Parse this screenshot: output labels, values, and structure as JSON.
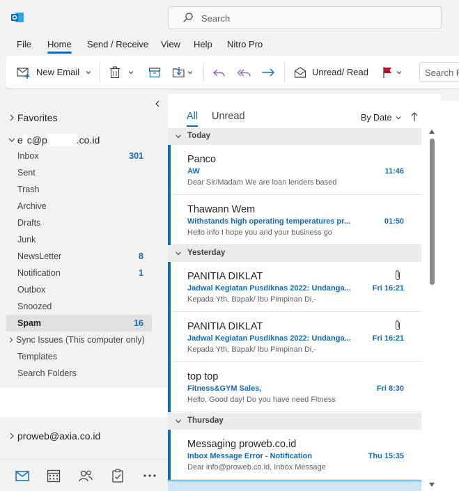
{
  "titlebar": {
    "app_icon": "outlook-logo-icon",
    "search": {
      "placeholder": "Search",
      "icon": "search-icon"
    }
  },
  "menu": {
    "tabs": [
      {
        "label": "File"
      },
      {
        "label": "Home",
        "active": true
      },
      {
        "label": "Send / Receive"
      },
      {
        "label": "View"
      },
      {
        "label": "Help"
      },
      {
        "label": "Nitro Pro"
      }
    ]
  },
  "ribbon": {
    "new_email": "New Email",
    "unread_read": "Unread/ Read",
    "search_placeholder": "Search P",
    "icons": [
      "new-email-icon",
      "delete-icon",
      "archive-icon",
      "move-icon",
      "undo-icon",
      "reply-all-icon",
      "forward-icon",
      "envelope-open-icon",
      "flag-icon"
    ]
  },
  "folders": {
    "favorites": "Favorites",
    "account_prefix": "e",
    "account_mid": "c@p",
    "account_suffix": ".co.id",
    "items": [
      {
        "name": "Inbox",
        "count": "301"
      },
      {
        "name": "Sent",
        "count": ""
      },
      {
        "name": "Trash",
        "count": ""
      },
      {
        "name": "Archive",
        "count": ""
      },
      {
        "name": "Drafts",
        "count": ""
      },
      {
        "name": "Junk",
        "count": ""
      },
      {
        "name": "NewsLetter",
        "count": "8"
      },
      {
        "name": "Notification",
        "count": "1"
      },
      {
        "name": "Outbox",
        "count": ""
      },
      {
        "name": "Snoozed",
        "count": ""
      },
      {
        "name": "Spam",
        "count": "16",
        "selected": true
      }
    ],
    "sync_issues": "Sync Issues (This computer only)",
    "templates": "Templates",
    "search_folders": "Search Folders",
    "account2": "proweb@axia.co.id"
  },
  "navbar": [
    "mail-icon",
    "calendar-icon",
    "people-icon",
    "tasks-icon",
    "more-icon"
  ],
  "list": {
    "filter_all": "All",
    "filter_unread": "Unread",
    "sort_label": "By Date",
    "groups": {
      "today": "Today",
      "yesterday": "Yesterday",
      "thursday": "Thursday"
    },
    "messages": [
      {
        "sender": "Panco",
        "subject": "AW",
        "time": "11:46",
        "preview": "Dear Sir/Madam  We are loan lenders based",
        "attachment": false
      },
      {
        "sender": "Thawann Wem",
        "subject": "Withstands high operating temperatures pr...",
        "time": "01:50",
        "preview": "Hello info  I hope you and your business go",
        "attachment": false
      },
      {
        "sender": "PANITIA DIKLAT",
        "subject": "Jadwal Kegiatan Pusdiknas 2022:  Undanga...",
        "time": "Fri 16:21",
        "preview": "Kepada Yth,  Bapak/  Ibu Pimpinan  Di,-",
        "attachment": true
      },
      {
        "sender": "PANITIA DIKLAT",
        "subject": "Jadwal Kegiatan Pusdiknas 2022:  Undanga...",
        "time": "Fri 16:21",
        "preview": "Kepada Yth,  Bapak/  Ibu Pimpinan  Di,-",
        "attachment": true
      },
      {
        "sender": "top top",
        "subject": "Fitness&GYM Sales,",
        "time": "Fri 8:30",
        "preview": "Hello,  Good day!  Do you have need Fitness",
        "attachment": false
      },
      {
        "sender": "Messaging proweb.co.id",
        "subject": "Inbox Message Error - Notification",
        "time": "Thu 15:35",
        "preview": "Dear info@proweb.co.id,  Inbox Message",
        "attachment": false
      }
    ]
  },
  "colors": {
    "accent": "#0f6cbd",
    "flag": "#c50f1f",
    "outlook_blue": "#0364b8"
  }
}
